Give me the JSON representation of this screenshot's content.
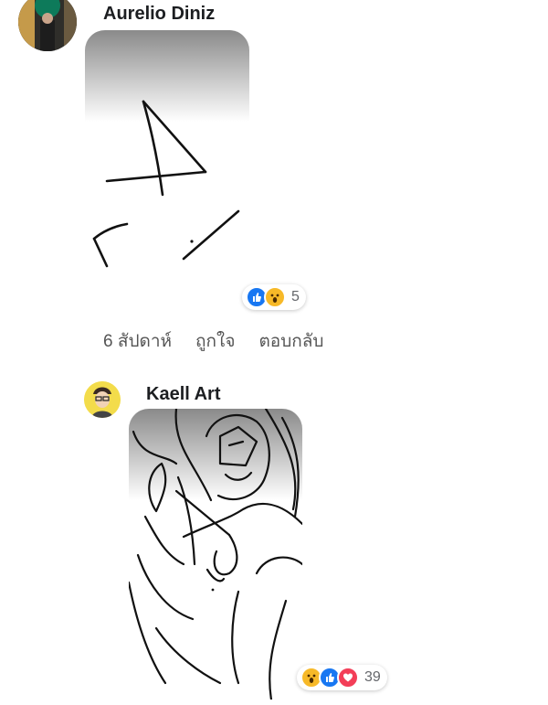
{
  "comments": [
    {
      "author": "Aurelio Diniz",
      "reactions": {
        "icons": [
          "like-icon",
          "wow-icon"
        ],
        "count": "5"
      },
      "actions": {
        "time": "6 สัปดาห์",
        "like": "ถูกใจ",
        "reply": "ตอบกลับ"
      }
    },
    {
      "author": "Kaell Art",
      "reactions": {
        "icons": [
          "wow-icon",
          "like-icon",
          "love-icon"
        ],
        "count": "39"
      }
    }
  ],
  "colors": {
    "like": "#1877f2",
    "wow": "#f7b928",
    "love": "#f33e58",
    "muted": "#65676b"
  }
}
